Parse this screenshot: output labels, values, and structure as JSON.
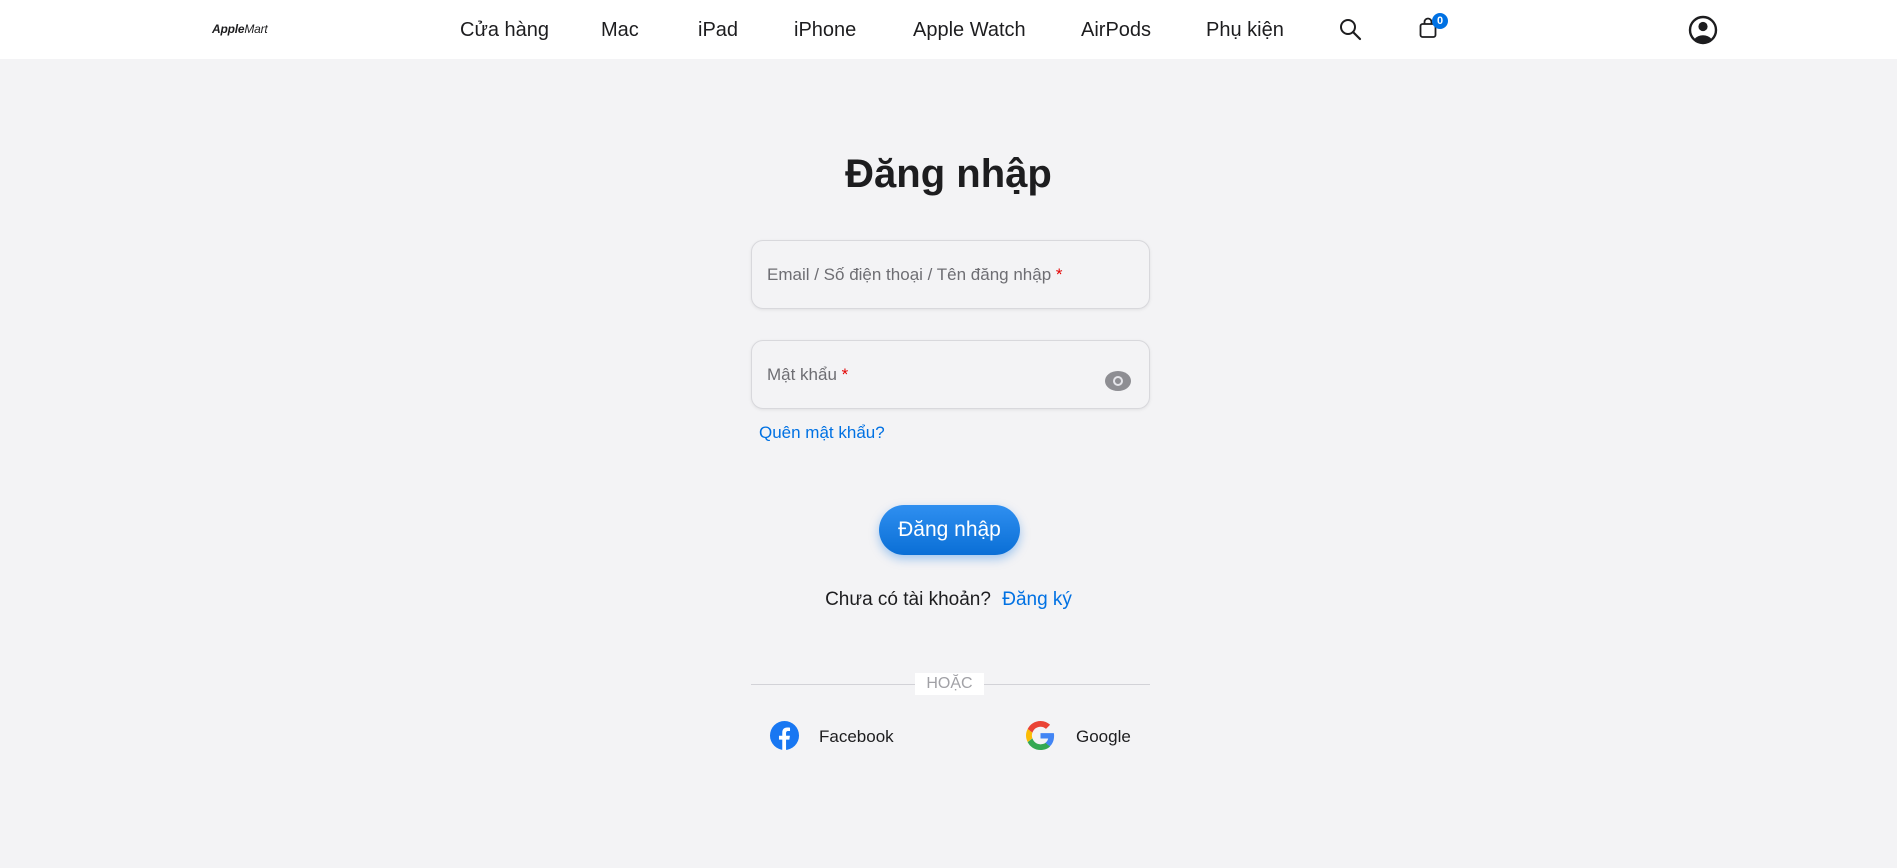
{
  "header": {
    "logo_brand": "Apple",
    "logo_suffix": "Mart",
    "nav": [
      {
        "label": "Cửa hàng"
      },
      {
        "label": "Mac"
      },
      {
        "label": "iPad"
      },
      {
        "label": "iPhone"
      },
      {
        "label": "Apple Watch"
      },
      {
        "label": "AirPods"
      },
      {
        "label": "Phụ kiện"
      }
    ],
    "cart_count": "0",
    "icons": {
      "search": "search-icon",
      "cart": "shopping-bag-icon",
      "account": "user-circle-icon"
    }
  },
  "login": {
    "title": "Đăng nhập",
    "username_placeholder": "Email / Số điện thoại / Tên đăng nhập",
    "password_placeholder": "Mật khẩu",
    "required_mark": "*",
    "forgot_password": "Quên mật khẩu?",
    "submit_label": "Đăng nhập",
    "no_account_text": "Chưa có tài khoản?",
    "signup_link": "Đăng ký",
    "or_label": "HOẶC",
    "social": [
      {
        "label": "Facebook",
        "icon": "facebook-icon"
      },
      {
        "label": "Google",
        "icon": "google-icon"
      }
    ]
  },
  "colors": {
    "accent": "#0071e3",
    "background": "#f3f3f5",
    "required": "#e30000"
  }
}
